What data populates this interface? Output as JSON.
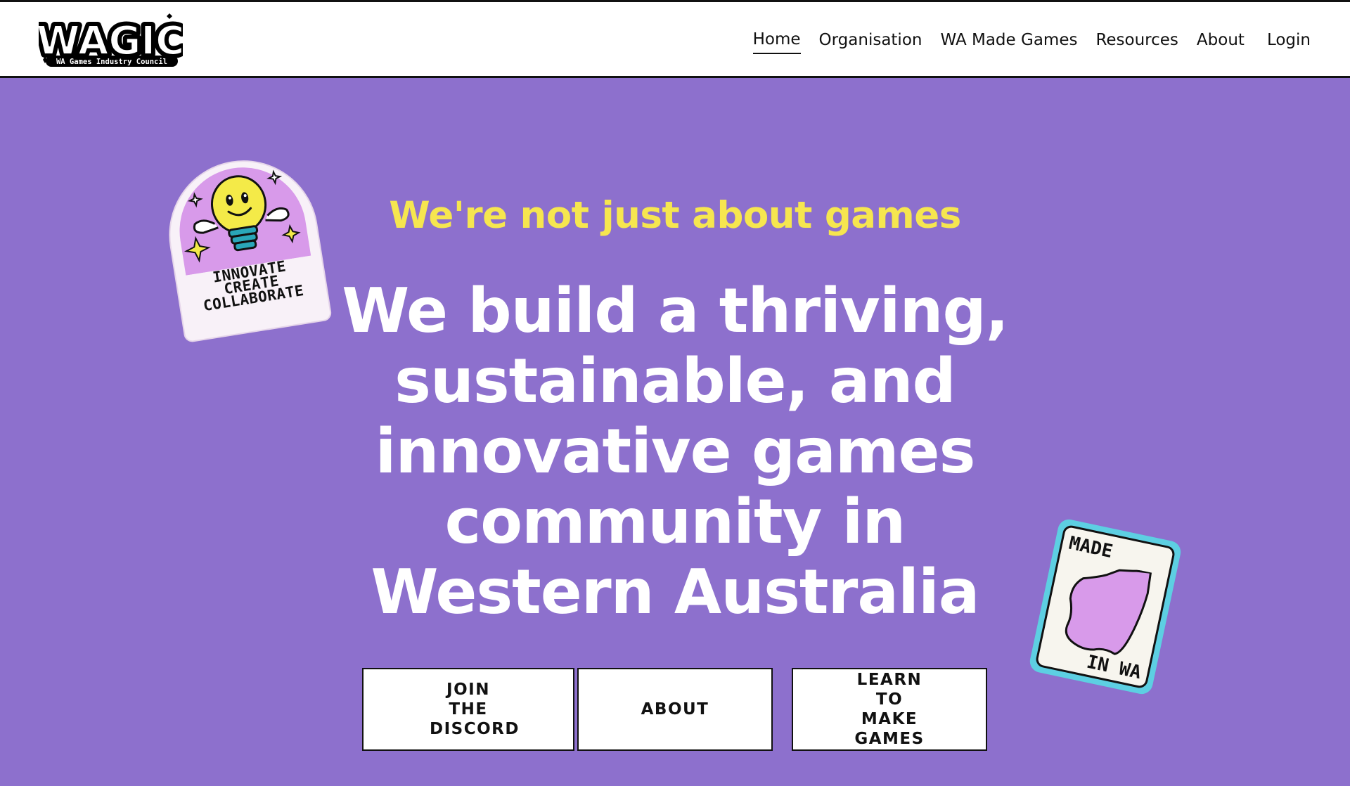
{
  "header": {
    "logo_text": "WAGIC",
    "logo_subtitle": "WA Games Industry Council",
    "nav": [
      {
        "label": "Home",
        "active": true
      },
      {
        "label": "Organisation"
      },
      {
        "label": "WA Made Games"
      },
      {
        "label": "Resources"
      },
      {
        "label": "About"
      },
      {
        "label": "Login"
      }
    ]
  },
  "hero": {
    "eyebrow": "We're not just about games",
    "headline": "We build a thriving, sustainable, and innovative games community in Western Australia",
    "buttons": {
      "discord": "JOIN THE DISCORD",
      "about": "ABOUT",
      "learn": "LEARN TO MAKE GAMES"
    }
  },
  "stickers": {
    "left_lines": [
      "INNOVATE",
      "CREATE",
      "COLLABORATE"
    ],
    "right_top": "MADE",
    "right_bottom": "IN WA"
  },
  "colors": {
    "background": "#8d70cd",
    "eyebrow": "#f6e64f",
    "headline": "#ffffff",
    "sticker_border": "#5dcfe2",
    "sticker_purple": "#d89aea"
  }
}
